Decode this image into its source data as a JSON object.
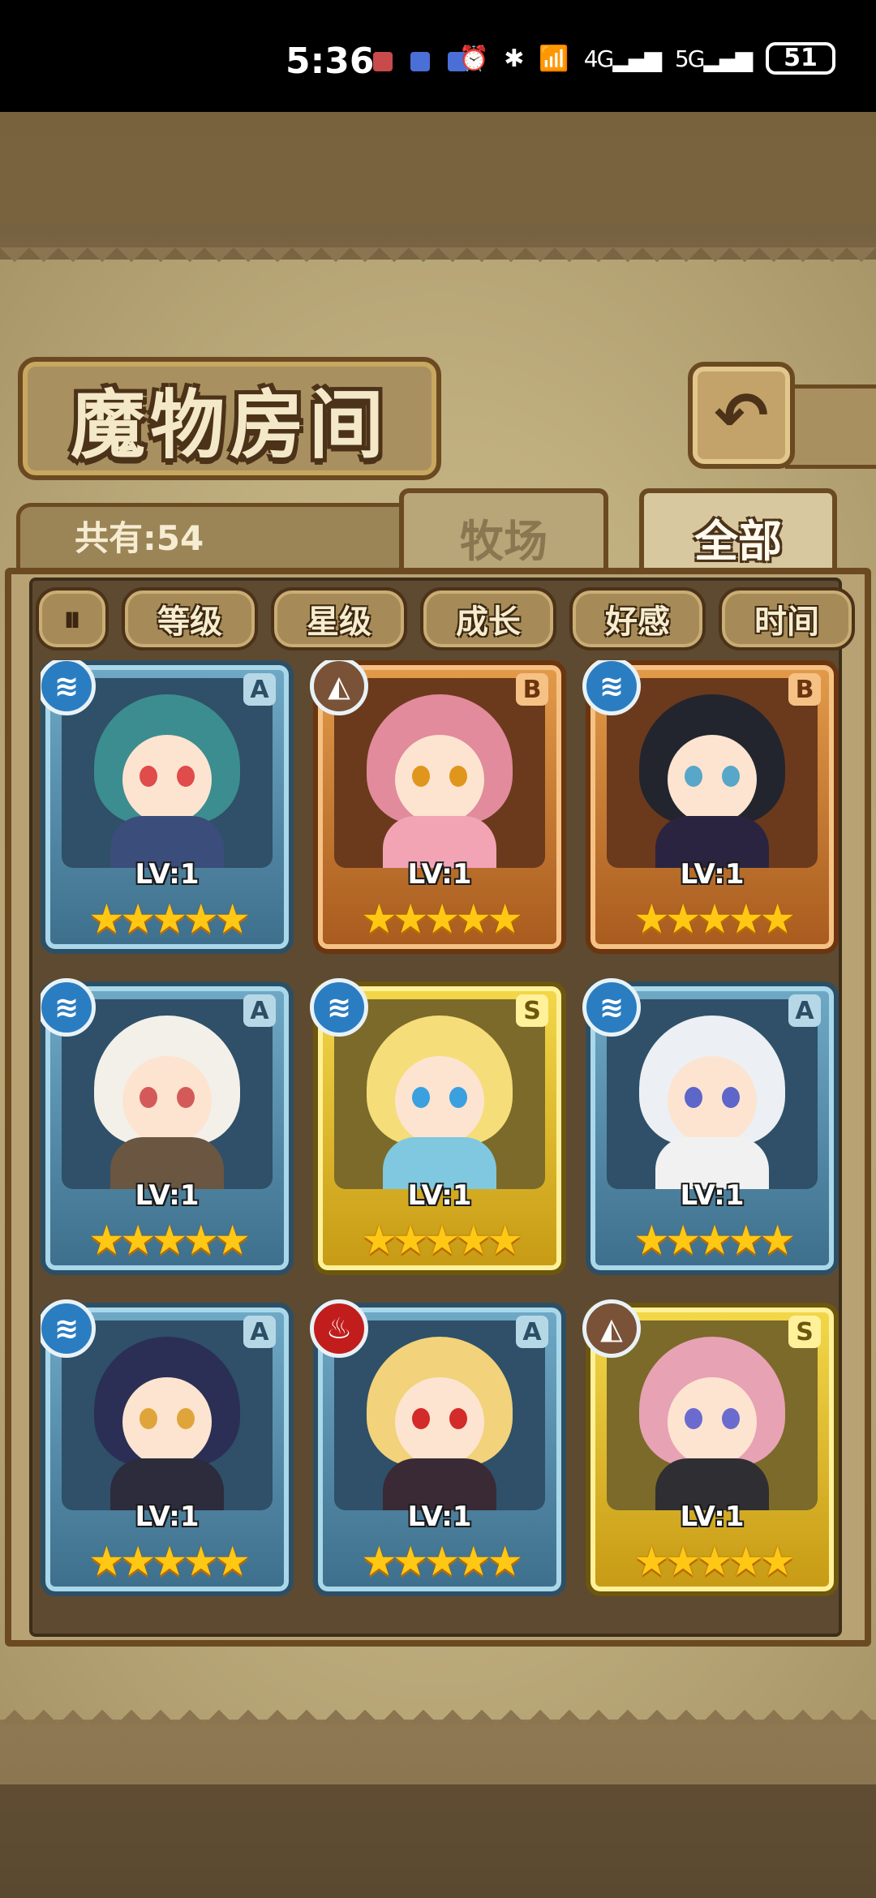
{
  "status_bar": {
    "time": "5:36",
    "network_4g": "4G",
    "network_5g": "5G",
    "battery": "51",
    "alarm_icon": "⏰",
    "bluetooth_icon": "✱",
    "wifi_icon": "📶"
  },
  "header": {
    "title": "魔物房间",
    "back_icon": "↶"
  },
  "summary": {
    "count_label": "共有:54"
  },
  "tabs": [
    {
      "label": "牧场",
      "active": false
    },
    {
      "label": "全部",
      "active": true
    }
  ],
  "sort": {
    "toggle_icon": "⏸",
    "options": [
      "等级",
      "星级",
      "成长",
      "好感",
      "时间"
    ]
  },
  "monsters": [
    {
      "element": "water",
      "element_icon": "≋",
      "grade": "A",
      "level": "LV:1",
      "stars": "★★★★★",
      "frame": "blue",
      "hair": "#3c8d8f",
      "eyes": "#e04b4b",
      "outfit": "#3b4d7a"
    },
    {
      "element": "earth",
      "element_icon": "◭",
      "grade": "B",
      "level": "LV:1",
      "stars": "★★★★★",
      "frame": "bronze",
      "hair": "#e18b9c",
      "eyes": "#e0961d",
      "outfit": "#f2a4b4"
    },
    {
      "element": "water",
      "element_icon": "≋",
      "grade": "B",
      "level": "LV:1",
      "stars": "★★★★★",
      "frame": "bronze",
      "hair": "#23252e",
      "eyes": "#58a6c8",
      "outfit": "#2a2440"
    },
    {
      "element": "water",
      "element_icon": "≋",
      "grade": "A",
      "level": "LV:1",
      "stars": "★★★★★",
      "frame": "blue",
      "hair": "#f3f0ea",
      "eyes": "#d45a5a",
      "outfit": "#6b5642"
    },
    {
      "element": "water",
      "element_icon": "≋",
      "grade": "S",
      "level": "LV:1",
      "stars": "★★★★★",
      "frame": "gold",
      "hair": "#f5dd7a",
      "eyes": "#3aa0e0",
      "outfit": "#7fc8df"
    },
    {
      "element": "water",
      "element_icon": "≋",
      "grade": "A",
      "level": "LV:1",
      "stars": "★★★★★",
      "frame": "blue",
      "hair": "#eceff4",
      "eyes": "#5d66c9",
      "outfit": "#f1f1f1"
    },
    {
      "element": "water",
      "element_icon": "≋",
      "grade": "A",
      "level": "LV:1",
      "stars": "★★★★★",
      "frame": "blue",
      "hair": "#2b2f55",
      "eyes": "#e0a53a",
      "outfit": "#2c2c3c"
    },
    {
      "element": "fire",
      "element_icon": "♨",
      "grade": "A",
      "level": "LV:1",
      "stars": "★★★★★",
      "frame": "blue",
      "hair": "#f2d27a",
      "eyes": "#d32a2a",
      "outfit": "#3a2a36"
    },
    {
      "element": "earth",
      "element_icon": "◭",
      "grade": "S",
      "level": "LV:1",
      "stars": "★★★★★",
      "frame": "gold",
      "hair": "#e7a2b4",
      "eyes": "#6b6bcf",
      "outfit": "#2f2f33"
    }
  ]
}
